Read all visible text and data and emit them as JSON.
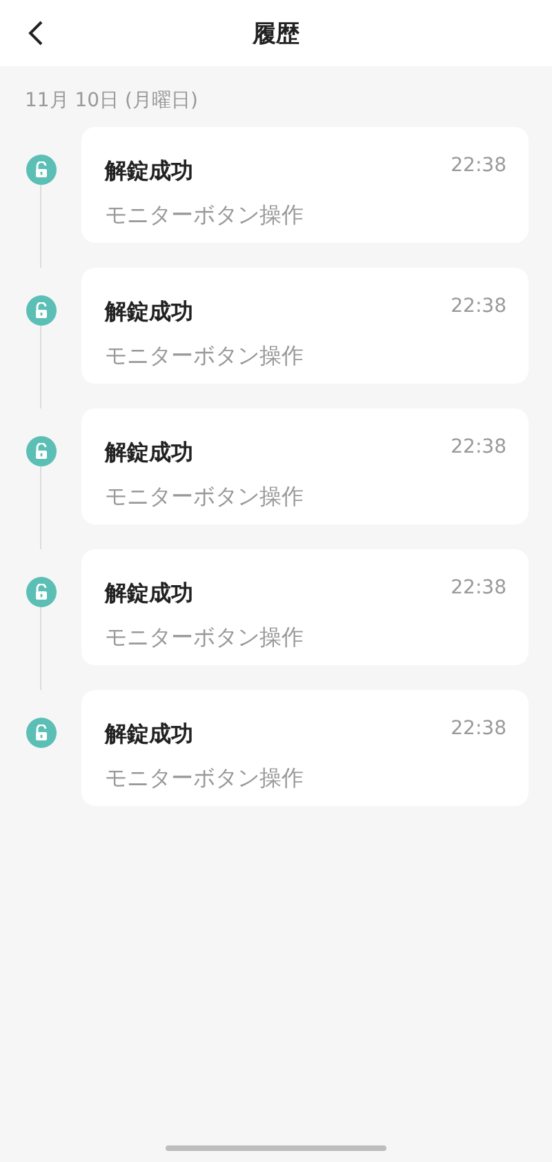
{
  "header": {
    "title": "履歴"
  },
  "date": "11月 10日 (月曜日)",
  "entries": [
    {
      "title": "解錠成功",
      "detail": "モニターボタン操作",
      "time": "22:38"
    },
    {
      "title": "解錠成功",
      "detail": "モニターボタン操作",
      "time": "22:38"
    },
    {
      "title": "解錠成功",
      "detail": "モニターボタン操作",
      "time": "22:38"
    },
    {
      "title": "解錠成功",
      "detail": "モニターボタン操作",
      "time": "22:38"
    },
    {
      "title": "解錠成功",
      "detail": "モニターボタン操作",
      "time": "22:38"
    }
  ]
}
